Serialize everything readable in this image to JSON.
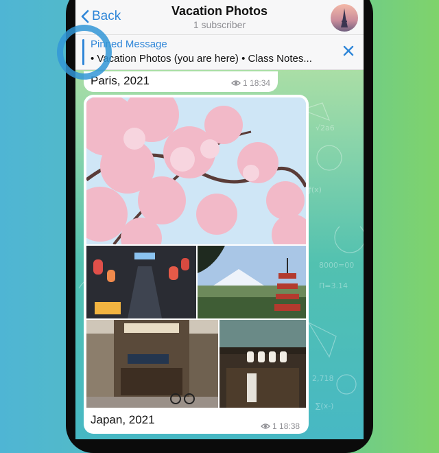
{
  "header": {
    "back_label": "Back",
    "title": "Vacation Photos",
    "subtitle": "1 subscriber"
  },
  "pinned": {
    "title": "Pinned Message",
    "text": "• Vacation Photos (you are here) • Class Notes..."
  },
  "messages": [
    {
      "caption": "Paris, 2021",
      "views": "1",
      "time": "18:34"
    },
    {
      "caption": "Japan, 2021",
      "views": "1",
      "time": "18:38"
    }
  ],
  "colors": {
    "accent": "#2f86d8",
    "ring": "#3296d7"
  },
  "icons": [
    "chevron-left-icon",
    "close-icon",
    "eye-icon"
  ]
}
